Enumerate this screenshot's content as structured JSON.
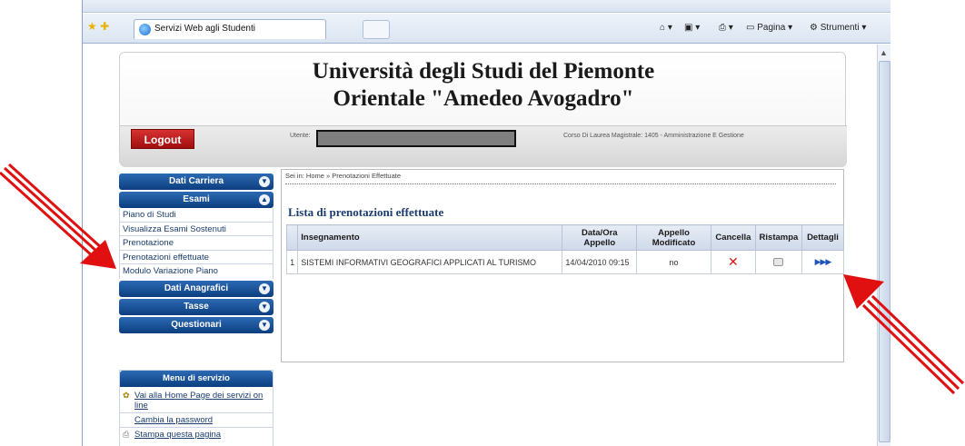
{
  "browser": {
    "tab_title": "Servizi Web agli Studenti",
    "commands": {
      "page": "Pagina",
      "tools": "Strumenti"
    }
  },
  "header": {
    "title_line1": "Università degli Studi del Piemonte",
    "title_line2": "Orientale \"Amedeo Avogadro\"",
    "logout": "Logout",
    "user_label": "Utente:",
    "course": "Corso Di Laurea Magistrale: 1405 - Amministrazione E Gestione"
  },
  "nav": {
    "dati_carriera": "Dati Carriera",
    "esami": "Esami",
    "esami_items": [
      "Piano di Studi",
      "Visualizza Esami Sostenuti",
      "Prenotazione",
      "Prenotazioni effettuate",
      "Modulo Variazione Piano"
    ],
    "dati_anagrafici": "Dati Anagrafici",
    "tasse": "Tasse",
    "questionari": "Questionari"
  },
  "service_menu": {
    "title": "Menu di servizio",
    "home_link": "Vai alla Home Page dei servizi on line",
    "password_link": "Cambia la password",
    "print_link": "Stampa questa pagina"
  },
  "main": {
    "breadcrumb": "Sei in: Home » Prenotazioni Effettuate",
    "list_title": "Lista di prenotazioni effettuate",
    "columns": [
      "Insegnamento",
      "Data/Ora Appello",
      "Appello Modificato",
      "Cancella",
      "Ristampa",
      "Dettagli"
    ],
    "rows": [
      {
        "num": "1",
        "course": "SISTEMI INFORMATIVI GEOGRAFICI APPLICATI AL TURISMO",
        "date": "14/04/2010 09:15",
        "modified": "no"
      }
    ]
  },
  "colors": {
    "nav_blue": "#0c3e80",
    "logout_red": "#c01818",
    "arrow_red": "#e01010"
  },
  "icons": {
    "delete": "x-icon",
    "reprint": "printer-icon",
    "details": "triple-arrow-icon"
  }
}
